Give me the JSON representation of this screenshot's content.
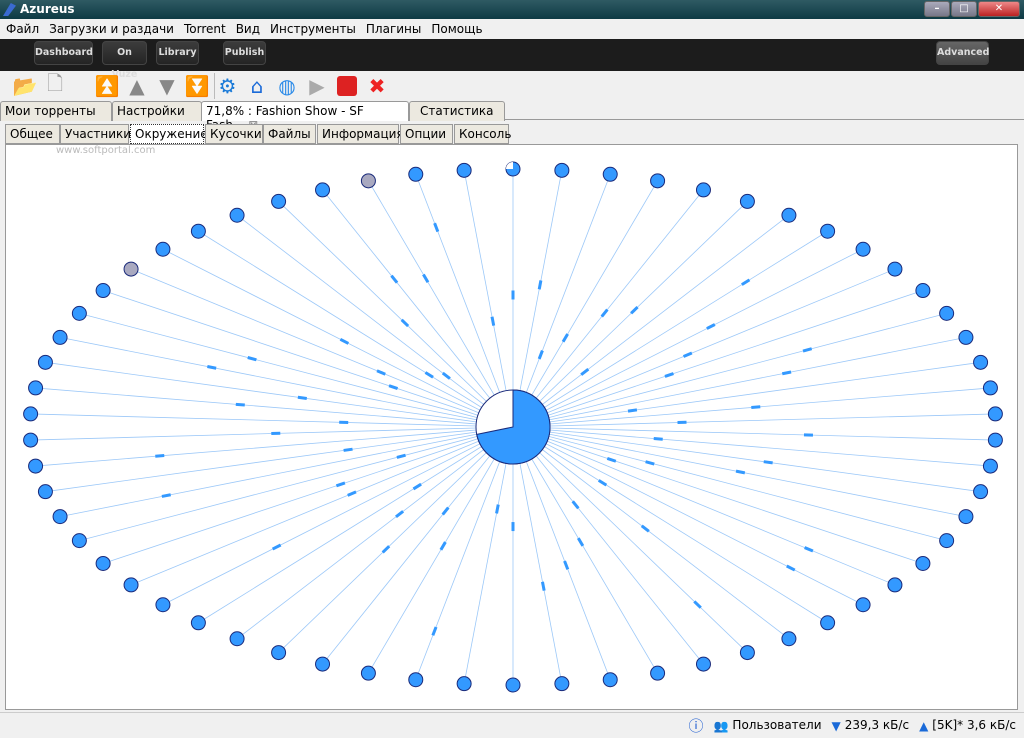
{
  "window": {
    "title": "Azureus"
  },
  "menu": [
    "Файл",
    "Загрузки и раздачи",
    "Torrent",
    "Вид",
    "Инструменты",
    "Плагины",
    "Помощь"
  ],
  "vuze_bar": {
    "buttons": [
      "Dashboard",
      "On Vuze",
      "Library",
      "Publish"
    ],
    "advanced": "Advanced"
  },
  "toolbar": [
    "open-folder-icon",
    "new-file-icon",
    "move-top-icon",
    "move-up-icon",
    "move-down-icon",
    "move-bottom-icon",
    "gear-icon",
    "home-icon",
    "globe-icon",
    "play-icon",
    "stop-icon",
    "remove-icon"
  ],
  "main_tabs": [
    "Мои торренты",
    "Настройки",
    "71,8% : Fashion Show - SF Fash...",
    "Статистика"
  ],
  "sub_tabs": [
    "Общее",
    "Участники",
    "Окружение",
    "Кусочки",
    "Файлы",
    "Информация",
    "Опции",
    "Консоль"
  ],
  "watermark": "www.softportal.com",
  "swarm": {
    "completion_percent": 71.8,
    "peer_count": 62,
    "grey_peers": [
      53,
      59
    ],
    "partial_peers": [
      0
    ],
    "accent": "#3399ff"
  },
  "status": {
    "users": "Пользователи",
    "down": "239,3 кБ/с",
    "up": "[5K]* 3,6 кБ/с"
  }
}
